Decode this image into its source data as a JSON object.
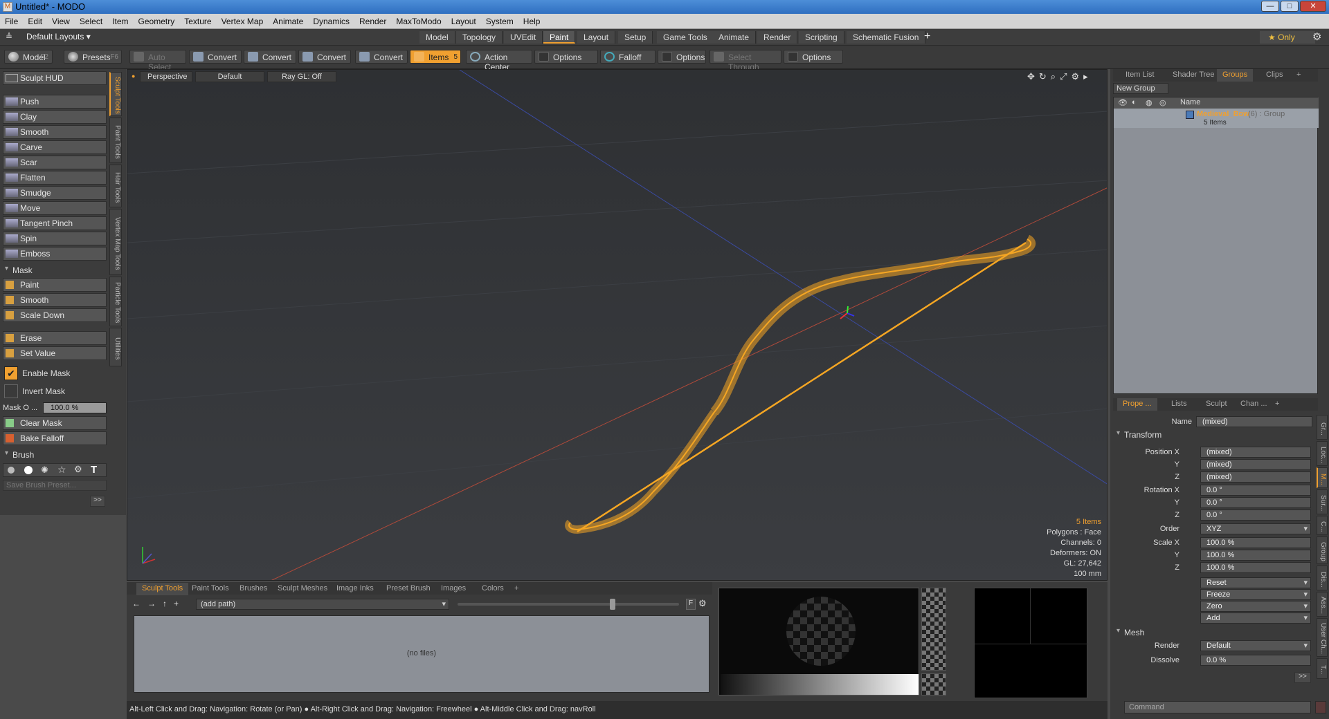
{
  "window": {
    "title": "Untitled* - MODO",
    "minimize": "—",
    "maximize": "□",
    "close": "✕"
  },
  "menu": [
    "File",
    "Edit",
    "View",
    "Select",
    "Item",
    "Geometry",
    "Texture",
    "Vertex Map",
    "Animate",
    "Dynamics",
    "Render",
    "MaxToModo",
    "Layout",
    "System",
    "Help"
  ],
  "layoutbar": {
    "layouts_label": "Default Layouts ▾",
    "tabs": [
      "Model",
      "Topology",
      "UVEdit",
      "Paint",
      "Layout",
      "Setup",
      "Game Tools",
      "Animate",
      "Render",
      "Scripting",
      "Schematic Fusion"
    ],
    "active_tab": "Paint",
    "add": "+",
    "only": "★ Only",
    "gear": "⚙"
  },
  "toolbar": {
    "model": "Model",
    "model_key": "F2",
    "presets": "Presets",
    "presets_key": "F6",
    "auto_select": "Auto Select",
    "convert1": "Convert",
    "convert2": "Convert",
    "convert3": "Convert",
    "convert4": "Convert",
    "items": "Items",
    "items_key": "5",
    "action_center": "Action Center",
    "options1": "Options",
    "falloff": "Falloff",
    "options2": "Options",
    "select_through": "Select Through",
    "options3": "Options"
  },
  "left": {
    "hud": "Sculpt HUD",
    "tools": [
      "Push",
      "Clay",
      "Smooth",
      "Carve",
      "Scar",
      "Flatten",
      "Smudge",
      "Move",
      "Tangent Pinch",
      "Spin",
      "Emboss"
    ],
    "mask_section": "Mask",
    "mask_tools": [
      "Paint",
      "Smooth",
      "Scale Down"
    ],
    "mask_tools2": [
      "Erase",
      "Set Value"
    ],
    "enable_mask": "Enable Mask",
    "invert_mask": "Invert Mask",
    "mask_opacity_label": "Mask O ...",
    "mask_opacity_value": "100.0 %",
    "clear_mask": "Clear Mask",
    "bake_falloff": "Bake Falloff",
    "brush_section": "Brush",
    "save_brush": "Save Brush Preset...",
    "more": ">>",
    "vtabs": [
      "Sculpt Tools",
      "Paint Tools",
      "Hair Tools",
      "Vertex Map Tools",
      "Particle Tools",
      "Utilities"
    ]
  },
  "viewport": {
    "perspective": "Perspective",
    "shading": "Default",
    "raygl": "Ray GL: Off",
    "info": [
      "5 Items",
      "Polygons : Face",
      "Channels: 0",
      "Deformers: ON",
      "GL: 27,642",
      "100 mm"
    ]
  },
  "bottom": {
    "tabs": [
      "Sculpt Tools",
      "Paint Tools",
      "Brushes",
      "Sculpt Meshes",
      "Image Inks",
      "Preset Brush",
      "Images",
      "Colors",
      "+"
    ],
    "active_tab": "Sculpt Tools",
    "path": "(add path)",
    "no_files": "(no files)",
    "f_btn": "F"
  },
  "status": "Alt-Left Click and Drag: Navigation: Rotate (or Pan) ● Alt-Right Click and Drag: Navigation: Freewheel ● Alt-Middle Click and Drag: navRoll",
  "right": {
    "tabs": [
      "Item List",
      "Shader Tree",
      "Groups",
      "Clips",
      "+"
    ],
    "active_tab": "Groups",
    "new_group": "New Group",
    "col_name": "Name",
    "group_name": "Medieval_Bow",
    "group_suffix": "(6) : Group",
    "group_items": "5 Items",
    "ptabs": [
      "Prope ...",
      "Lists",
      "Sculpt",
      "Chan ...",
      "+"
    ],
    "name_label": "Name",
    "name_value": "(mixed)",
    "transform": "Transform",
    "position_label": "Position X",
    "pos": [
      "(mixed)",
      "(mixed)",
      "(mixed)"
    ],
    "rotation_label": "Rotation X",
    "rot": [
      "0.0 °",
      "0.0 °",
      "0.0 °"
    ],
    "order_label": "Order",
    "order": "XYZ",
    "scale_label": "Scale X",
    "scale": [
      "100.0 %",
      "100.0 %",
      "100.0 %"
    ],
    "y": "Y",
    "z": "Z",
    "actions": [
      "Reset",
      "Freeze",
      "Zero",
      "Add"
    ],
    "mesh": "Mesh",
    "render_label": "Render",
    "render": "Default",
    "dissolve_label": "Dissolve",
    "dissolve": "0.0 %",
    "more": ">>",
    "command": "Command",
    "side_tabs": [
      "Gr...",
      "Loc...",
      "M...",
      "Sur...",
      "C...",
      "Group",
      "Dis...",
      "Ass...",
      "User Ch...",
      "T..."
    ]
  },
  "colors": {
    "accent": "#f0a030",
    "mesh": "#f5a623"
  }
}
